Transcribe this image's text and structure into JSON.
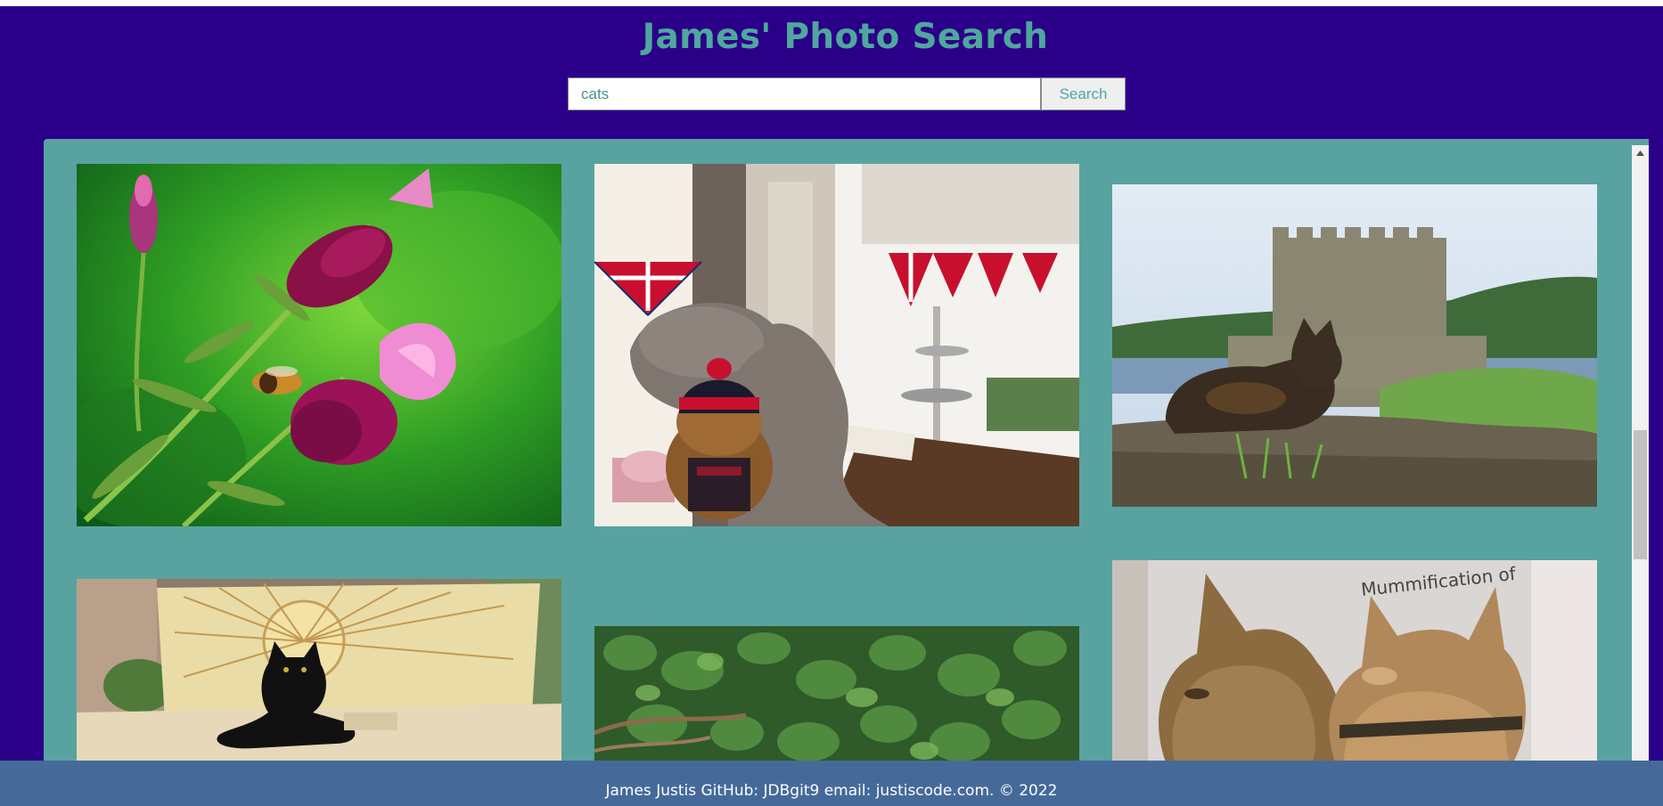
{
  "header": {
    "title": "James' Photo Search"
  },
  "search": {
    "value": "cats",
    "button_label": "Search"
  },
  "gallery": {
    "photos": [
      {
        "name": "photo-lavender-bee",
        "subject": "lavender flowers with a bee"
      },
      {
        "name": "photo-cat-teddy-bear-cafe",
        "subject": "cat and teddy bear by a cafe window with union jack bunting"
      },
      {
        "name": "photo-cat-castle",
        "subject": "tortoiseshell cat lying in front of a stone castle tower"
      },
      {
        "name": "photo-black-cat-bench",
        "subject": "black cat on a carved sunburst bench"
      },
      {
        "name": "photo-ivy-leaves",
        "subject": "ivy leaves"
      },
      {
        "name": "photo-cat-mummies",
        "subject": "cat mummies in a museum display"
      }
    ],
    "museum_sign_text": "Mummification of"
  },
  "footer": {
    "text": "James Justis GitHub: JDBgit9 email: justiscode.com. © 2022"
  },
  "colors": {
    "background": "#2b0088",
    "accent": "#4fa79e",
    "gallery": "#58a3a0",
    "footer": "#456a9a"
  }
}
